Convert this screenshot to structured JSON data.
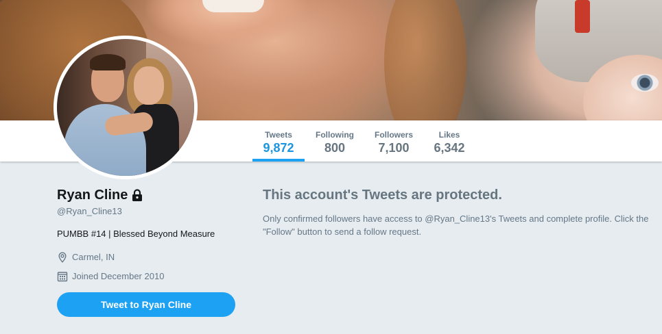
{
  "profile": {
    "name": "Ryan Cline",
    "handle": "@Ryan_Cline13",
    "bio": "PUMBB #14 | Blessed Beyond Measure",
    "location": "Carmel, IN",
    "joined": "Joined December 2010",
    "tweet_to_button": "Tweet to Ryan Cline"
  },
  "nav": {
    "tweets": {
      "label": "Tweets",
      "value": "9,872"
    },
    "following": {
      "label": "Following",
      "value": "800"
    },
    "followers": {
      "label": "Followers",
      "value": "7,100"
    },
    "likes": {
      "label": "Likes",
      "value": "6,342"
    },
    "active": "tweets"
  },
  "protected": {
    "title": "This account's Tweets are protected.",
    "body": "Only confirmed followers have access to @Ryan_Cline13's Tweets and complete profile. Click the \"Follow\" button to send a follow request."
  },
  "icons": {
    "lock": "lock-icon",
    "location": "location-pin-icon",
    "calendar": "calendar-icon"
  },
  "colors": {
    "accent": "#1da1f2",
    "page_bg": "#e6ecf0",
    "active_stat": "#1b95e0",
    "muted": "#657786"
  }
}
